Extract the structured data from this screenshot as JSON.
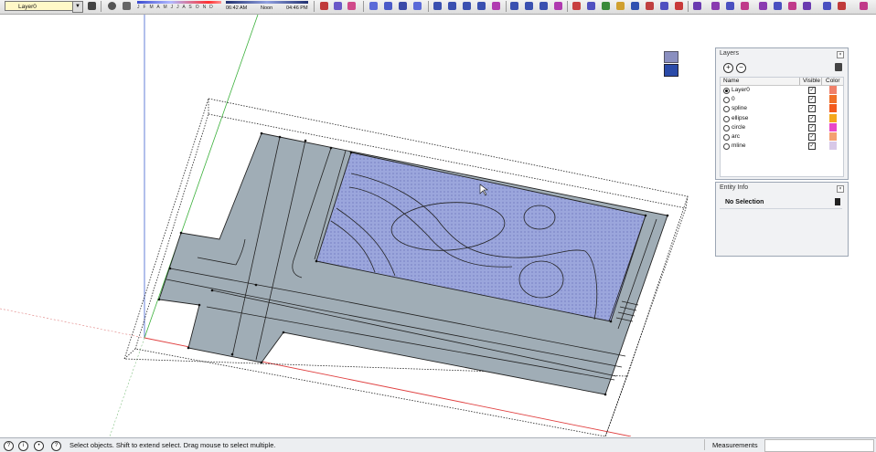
{
  "toolbar": {
    "layer_selected": "Layer0",
    "months": "J F M A M J J A S O N D",
    "time_start": "06:42 AM",
    "time_noon": "Noon",
    "time_end": "04:46 PM"
  },
  "layers_panel": {
    "title": "Layers",
    "columns": {
      "name": "Name",
      "visible": "Visible",
      "color": "Color"
    },
    "rows": [
      {
        "name": "Layer0",
        "active": true,
        "visible": true,
        "color": "#f0806a"
      },
      {
        "name": "0",
        "active": false,
        "visible": true,
        "color": "#f07028"
      },
      {
        "name": "spline",
        "active": false,
        "visible": true,
        "color": "#f35a1c"
      },
      {
        "name": "ellipse",
        "active": false,
        "visible": true,
        "color": "#f4a81c"
      },
      {
        "name": "circle",
        "active": false,
        "visible": true,
        "color": "#e848c8"
      },
      {
        "name": "arc",
        "active": false,
        "visible": true,
        "color": "#f4a070"
      },
      {
        "name": "mline",
        "active": false,
        "visible": true,
        "color": "#d8c8e8"
      }
    ]
  },
  "entity_panel": {
    "title": "Entity Info",
    "selection": "No Selection"
  },
  "status": {
    "hint": "Select objects. Shift to extend select. Drag mouse to select multiple.",
    "measurements_label": "Measurements",
    "measurements_value": ""
  },
  "colors": {
    "toolbar_bg": "#e4e4e4",
    "model_fill": "#a0adb6",
    "hatch": "#8a95d8",
    "axis_red": "#e04040",
    "axis_green": "#3ab03a",
    "axis_blue": "#4060d0"
  }
}
